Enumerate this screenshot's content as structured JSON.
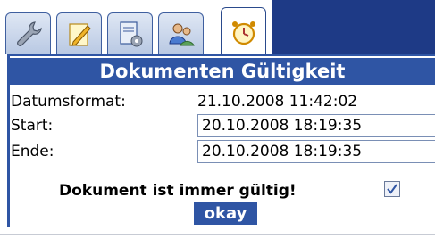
{
  "tabs": [
    {
      "icon": "wrench-icon",
      "active": false
    },
    {
      "icon": "edit-document-icon",
      "active": false
    },
    {
      "icon": "document-settings-icon",
      "active": false
    },
    {
      "icon": "users-icon",
      "active": false
    },
    {
      "icon": "alarm-clock-icon",
      "active": true
    }
  ],
  "panel": {
    "title": "Dokumenten Gültigkeit",
    "date_format_label": "Datumsformat:",
    "date_format_value": "21.10.2008 11:42:02",
    "start_label": "Start:",
    "start_value": "20.10.2008 18:19:35",
    "end_label": "Ende:",
    "end_value": "20.10.2008 18:19:35",
    "always_valid_label": "Dokument ist immer gültig!",
    "always_valid_checked": true,
    "okay_label": "okay"
  },
  "colors": {
    "header_bar": "#2f55a4",
    "tabbar_fill": "#1e3a86"
  }
}
